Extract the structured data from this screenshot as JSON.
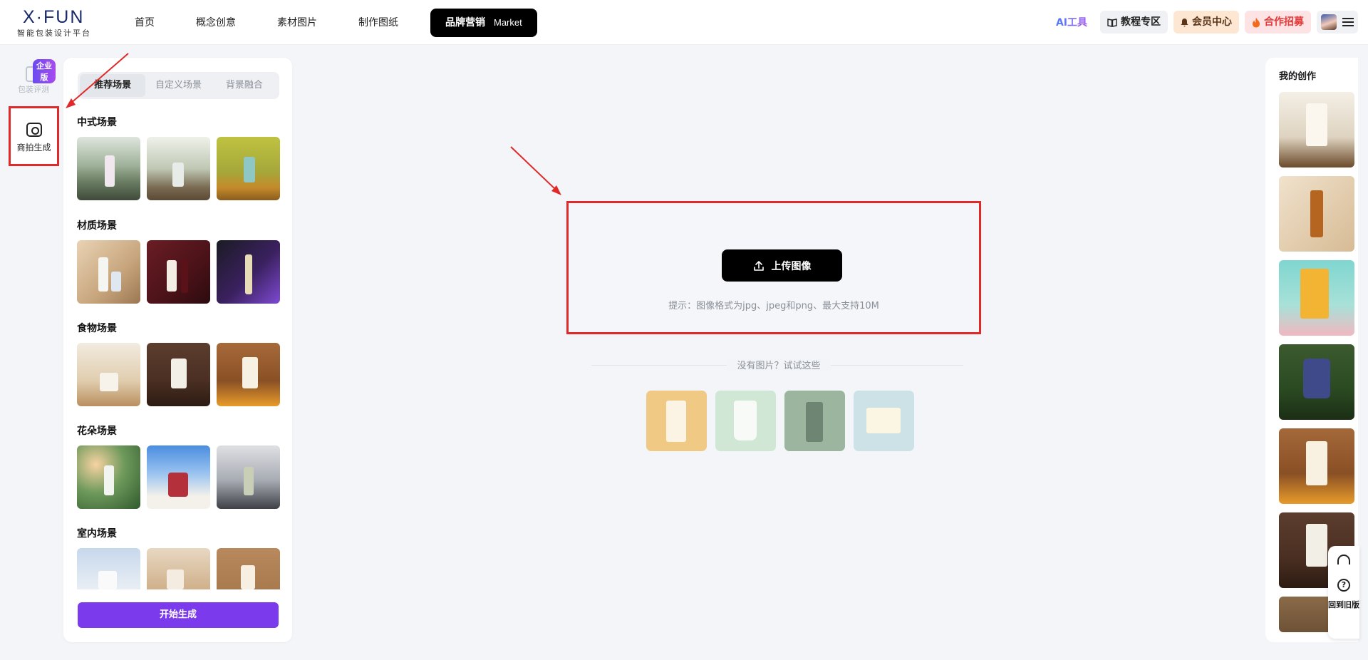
{
  "logo": {
    "mark": "X·FUN",
    "subtitle": "智能包装设计平台"
  },
  "nav": {
    "items": [
      "首页",
      "概念创意",
      "素材图片",
      "制作图纸"
    ],
    "active": {
      "label": "品牌营销",
      "tag": "Market"
    }
  },
  "header_right": {
    "ai_tools": "AI工具",
    "tutorial": "教程专区",
    "member": "会员中心",
    "partner": "合作招募"
  },
  "rail": {
    "eval_badge": "企业版",
    "eval_label": "包装评测",
    "shoot_label": "商拍生成"
  },
  "scene_panel": {
    "tabs": [
      "推荐场景",
      "自定义场景",
      "背景融合"
    ],
    "categories": [
      "中式场景",
      "材质场景",
      "食物场景",
      "花朵场景",
      "室内场景"
    ],
    "generate_label": "开始生成"
  },
  "upload": {
    "button_label": "上传图像",
    "hint": "提示：图像格式为jpg、jpeg和png、最大支持10M",
    "try_text": "没有图片？试试这些"
  },
  "my_works": {
    "title": "我的创作"
  },
  "float_bar": {
    "back_label": "回到旧版"
  },
  "colors": {
    "accent": "#7c3aed",
    "highlight": "#e02a2a",
    "dark": "#000000"
  },
  "icons": [
    "upload-icon",
    "camera-plus-icon",
    "headset-icon",
    "question-icon",
    "menu-icon",
    "book-icon",
    "bell-icon",
    "fire-icon"
  ]
}
